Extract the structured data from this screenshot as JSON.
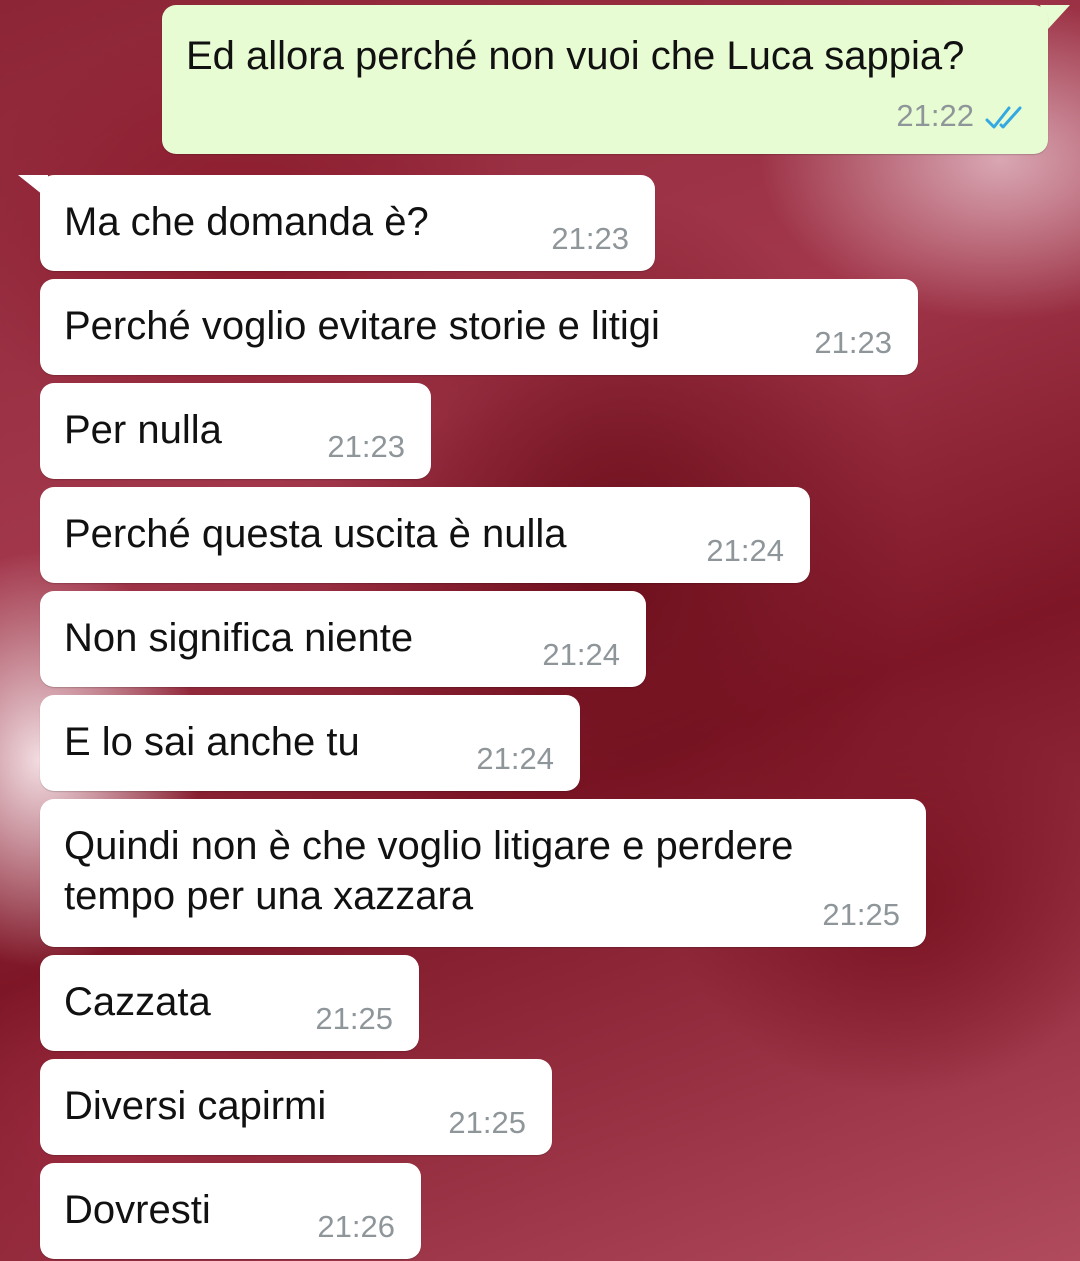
{
  "messages": [
    {
      "direction": "out",
      "text": "Ed allora perché non vuoi che Luca sappia?",
      "time": "21:22",
      "status_icon": "double-check-read-icon",
      "status_color": "#34a8e0"
    },
    {
      "direction": "in",
      "text": "Ma che domanda è?",
      "time": "21:23"
    },
    {
      "direction": "in",
      "text": "Perché voglio evitare storie e litigi",
      "time": "21:23"
    },
    {
      "direction": "in",
      "text": "Per nulla",
      "time": "21:23"
    },
    {
      "direction": "in",
      "text": "Perché questa uscita è nulla",
      "time": "21:24"
    },
    {
      "direction": "in",
      "text": "Non significa niente",
      "time": "21:24"
    },
    {
      "direction": "in",
      "text": "E lo sai anche tu",
      "time": "21:24"
    },
    {
      "direction": "in",
      "text_line1": "Quindi non è che voglio litigare e perdere",
      "text_line2": "tempo per una xazzara",
      "time": "21:25"
    },
    {
      "direction": "in",
      "text": "Cazzata",
      "time": "21:25"
    },
    {
      "direction": "in",
      "text": "Diversi capirmi",
      "time": "21:25"
    },
    {
      "direction": "in",
      "text": "Dovresti",
      "time": "21:26"
    }
  ],
  "colors": {
    "outgoing_bubble": "#e7fcd2",
    "incoming_bubble": "#ffffff",
    "timestamp": "#8f969a",
    "read_ticks": "#34a8e0"
  }
}
